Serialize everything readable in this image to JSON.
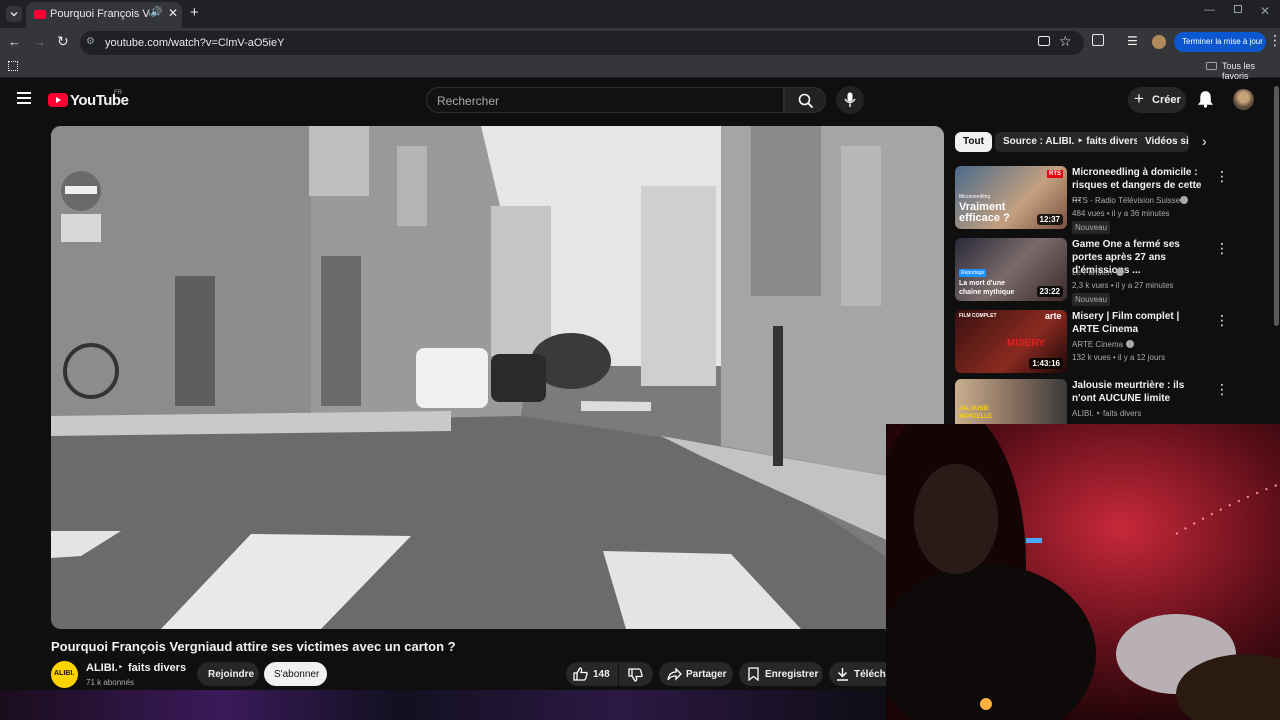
{
  "browser": {
    "tab_title": "Pourquoi François Vergniaud",
    "url": "youtube.com/watch?v=ClmV-aO5ieY",
    "update_button": "Terminer la mise à jour",
    "all_bookmarks": "Tous les favoris"
  },
  "youtube": {
    "region": "FR",
    "search_placeholder": "Rechercher",
    "create_label": "Créer",
    "video": {
      "title": "Pourquoi François Vergniaud attire ses victimes avec un carton ?",
      "channel_name": "ALIBI.",
      "channel_suffix": "faits divers",
      "subscribers": "71 k abonnés",
      "avatar_text": "ALIBI.",
      "join_label": "Rejoindre",
      "subscribe_label": "S'abonner",
      "likes": "148",
      "share_label": "Partager",
      "save_label": "Enregistrer",
      "download_label": "Téléchar"
    },
    "chips": [
      "Tout",
      "Source : ALIBI. ‣ faits divers",
      "Vidéos sim"
    ],
    "recommendations": [
      {
        "title": "Microneedling à domicile : risques et dangers de cette ...",
        "channel": "RTS - Radio Télévision Suisse",
        "stats": "484 vues • il y a 36 minutes",
        "badge": "Nouveau",
        "duration": "12:37",
        "thumb_text": "Vraiment efficace ?",
        "thumb_sub": "Microneedling",
        "thumb_logo": "RTS"
      },
      {
        "title": "Game One a fermé ses portes après 27 ans d'émissions ...",
        "channel": "Le Parisien",
        "stats": "2,3 k vues • il y a 27 minutes",
        "badge": "Nouveau",
        "duration": "23:22",
        "thumb_text": "La mort d'une chaîne mythique",
        "thumb_sub": "Reportage"
      },
      {
        "title": "Misery | Film complet | ARTE Cinema",
        "channel": "ARTE Cinema",
        "stats": "132 k vues • il y a 12 jours",
        "duration": "1:43:16",
        "thumb_text": "MISERY",
        "thumb_sub": "FILM COMPLET",
        "thumb_logo": "arte"
      },
      {
        "title": "Jalousie meurtrière : ils n'ont AUCUNE limite",
        "channel": "ALIBI. ‣ faits divers",
        "thumb_text": "JALOUSIE MORTELLE"
      }
    ]
  }
}
